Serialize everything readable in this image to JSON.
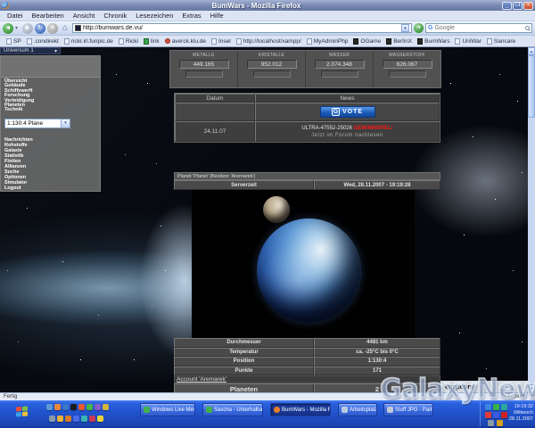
{
  "window": {
    "title": "BumWars - Mozilla Firefox"
  },
  "menubar": {
    "items": [
      "Datei",
      "Bearbeiten",
      "Ansicht",
      "Chronik",
      "Lesezeichen",
      "Extras",
      "Hilfe"
    ]
  },
  "navbar": {
    "url": "http://bumwars.de.vu/",
    "search_placeholder": "Google"
  },
  "bookmarks": {
    "items": [
      "SP",
      ".condirekt",
      "rickr.irl.funpic.de",
      "Ricki",
      "link",
      "averck.klu.de",
      "Insel",
      "http://localhost/xampp/",
      "MyAdminPhp",
      "OGame",
      "BerlinX",
      "BumWars",
      "UniWar",
      "Sancare"
    ]
  },
  "sidebar": {
    "universe": "Universum 1",
    "menu_top": [
      "Übersicht",
      "Gebäude",
      "Schiffswerft",
      "Forschung",
      "Verteidigung",
      "Planeten",
      "Technik"
    ],
    "planet_select": "1:130:4 Plane",
    "menu_bottom": [
      "Nachrichten",
      "Rohstoffe",
      "Galaxie",
      "Statistik",
      "Flotten",
      "Allianzen",
      "Suche",
      "Optionen",
      "Simulator",
      "Logout"
    ]
  },
  "resources": [
    {
      "label": "Metalle",
      "value": "449.165"
    },
    {
      "label": "Kristalle",
      "value": "952.012"
    },
    {
      "label": "Wasser",
      "value": "2.074.348"
    },
    {
      "label": "Wasserstoff",
      "value": "626.067"
    }
  ],
  "news": {
    "col_datum": "Datum",
    "col_news": "News",
    "vote_g": "G",
    "vote_label": "VOTE",
    "row_date": "24.11.07",
    "line1_white": "ULTRA-47552-25026",
    "line1_red": "GEWINNSPIEL!",
    "line2": "Jetzt im Forum nachlesen"
  },
  "planet_panel": {
    "title": "Planet 'Planet' (Besitzer 'Aremarek')",
    "server_label": "Serverzeit",
    "server_value": "Wed, 28.11.2007 - 19:19:28",
    "rows": [
      {
        "label": "Durchmesser",
        "value": "4481 km"
      },
      {
        "label": "Temperatur",
        "value": "ca. -25°C bis 0°C"
      },
      {
        "label": "Position",
        "value": "1:130:4"
      },
      {
        "label": "Punkte",
        "value": "171"
      }
    ],
    "account_title": "Account 'Aremarek'",
    "planeten_label": "Planeten",
    "planeten_value": "2",
    "corner_text": "emy.com"
  },
  "statusbar": {
    "left": "Fertig",
    "right": "Adblock"
  },
  "taskbar": {
    "tasks": [
      {
        "label": "Windows Live Messen..."
      },
      {
        "label": "Sascha - Unterhaltung"
      },
      {
        "label": "BumWars - Mozilla Fir..."
      },
      {
        "label": "Arbeitsplatz"
      },
      {
        "label": "Stuff JPG - Pain"
      }
    ],
    "clock": {
      "time": "19:19:32",
      "day": "Mittwoch",
      "date": "28.11.2007"
    }
  },
  "watermark": "GalaxyNews",
  "colors": {
    "taskbar_blue": "#245edb",
    "news_alert_red": "#ff1a1a",
    "vote_blue": "#1a5ab8"
  }
}
